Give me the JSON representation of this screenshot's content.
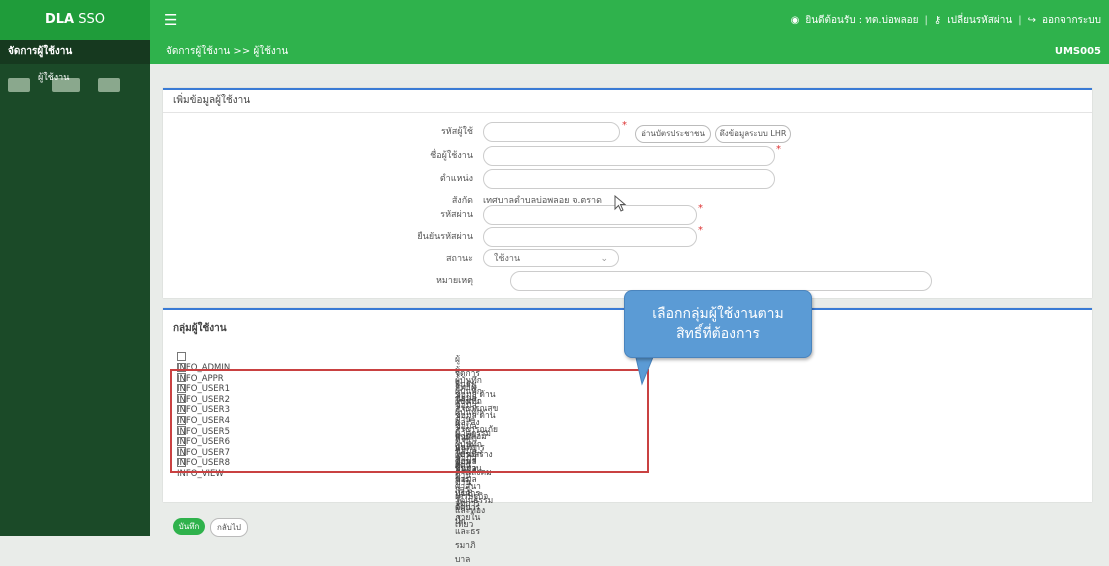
{
  "app": {
    "brand_bold": "DLA",
    "brand_light": " SSO"
  },
  "topnav": {
    "welcome": "ยินดีต้อนรับ : ทต.บ่อพลอย",
    "change_password": "เปลี่ยนรหัสผ่าน",
    "logout": "ออกจากระบบ",
    "separator": "|"
  },
  "sidebar": {
    "heading": "จัดการผู้ใช้งาน",
    "items": [
      {
        "label": "ผู้ใช้งาน"
      }
    ]
  },
  "subbar": {
    "breadcrumb": "จัดการผู้ใช้งาน >> ผู้ใช้งาน",
    "code": "UMS005"
  },
  "form": {
    "title": "เพิ่มข้อมูลผู้ใช้งาน",
    "user_code_label": "รหัสผู้ใช้",
    "read_card_button": "อ่านบัตรประชาชน",
    "fetch_lhr_button": "ดึงข้อมูลระบบ LHR",
    "username_label": "ชื่อผู้ใช้งาน",
    "position_label": "ตำแหน่ง",
    "org_label": "สังกัด",
    "org_value": "เทศบาลตำบลบ่อพลอย จ.ตราด",
    "password_label": "รหัสผ่าน",
    "confirm_password_label": "ยืนยันรหัสผ่าน",
    "status_label": "สถานะ",
    "status_value": "ใช้งาน",
    "note_label": "หมายเหตุ",
    "required_mark": "*"
  },
  "groups": {
    "title": "กลุ่มผู้ใช้งาน",
    "items": [
      {
        "name": "INFO_ADMIN",
        "desc": "ผู้จัดการสิทธิผู้ใช้งาน"
      },
      {
        "name": "INFO_APPR",
        "desc": "ผู้ยืนยันข้อมูล"
      },
      {
        "name": "INFO_USER1",
        "desc": "ผู้บันทึกข้อมูล ด้านสาธารณสุขและสิ่งแวดล้อม"
      },
      {
        "name": "INFO_USER2",
        "desc": "ผู้บันทึกข้อมูล ด้านนวัตกรรมและการศึกษา"
      },
      {
        "name": "INFO_USER3",
        "desc": "ผู้บันทึกข้อมูล ด้านสาธารณภัย"
      },
      {
        "name": "INFO_USER4",
        "desc": "ผู้บันทึกข้อมูล ด้านโครงสร้างพื้นฐาน"
      },
      {
        "name": "INFO_USER5",
        "desc": "ผู้บันทึกข้อมูล ด้านการบริหารจัดการน้ำ"
      },
      {
        "name": "INFO_USER6",
        "desc": "ผู้บันทึกข้อมูล ด้านการจัดการภายในและธรรมาภิบาล"
      },
      {
        "name": "INFO_USER7",
        "desc": "ผู้บันทึกข้อมูล ด้านสังคม ศาสนา วัฒนธรรม"
      },
      {
        "name": "INFO_USER8",
        "desc": "ผู้บันทึกข้อมูล ด้านเศรษฐกิจและท่องเที่ยว"
      },
      {
        "name": "INFO_VIEW",
        "desc": "ผู้ดูข้อมูลทั้ง 8 ด้าน"
      }
    ]
  },
  "callout": {
    "line1": "เลือกกลุ่มผู้ใช้งานตาม",
    "line2": "สิทธิ์ที่ต้องการ"
  },
  "actions": {
    "save": "บันทึก",
    "back": "กลับไป"
  },
  "colors": {
    "primary_green": "#2fb24c",
    "sidebar_dark": "#1b4a28",
    "accent_blue": "#3a7bd5",
    "highlight_red": "#c94141",
    "callout_blue": "#5b9bd5"
  }
}
